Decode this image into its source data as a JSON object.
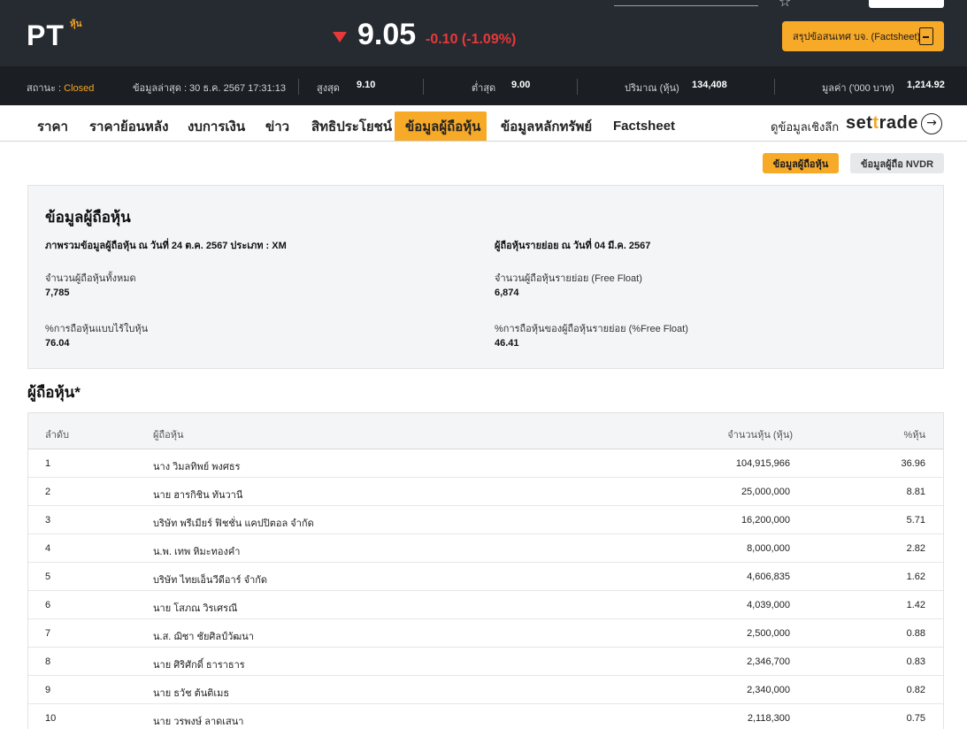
{
  "header": {
    "symbol": "PT",
    "symbol_tag": "หุ้น",
    "price": "9.05",
    "change": "-0.10 (-1.09%)",
    "factsheet_label": "สรุปข้อสนเทศ บจ. (Factsheet)"
  },
  "stats": {
    "status_label": "สถานะ :",
    "status_value": "Closed",
    "updated": "ข้อมูลล่าสุด : 30 ธ.ค. 2567 17:31:13",
    "high_label": "สูงสุด",
    "high_value": "9.10",
    "low_label": "ต่ำสุด",
    "low_value": "9.00",
    "volume_label": "ปริมาณ (หุ้น)",
    "volume_value": "134,408",
    "value_label": "มูลค่า ('000 บาท)",
    "value_value": "1,214.92"
  },
  "tabs": [
    {
      "label": "ราคา"
    },
    {
      "label": "ราคาย้อนหลัง"
    },
    {
      "label": "งบการเงิน"
    },
    {
      "label": "ข่าว"
    },
    {
      "label": "สิทธิประโยชน์"
    },
    {
      "label": "ข้อมูลผู้ถือหุ้น"
    },
    {
      "label": "ข้อมูลหลักทรัพย์"
    },
    {
      "label": "Factsheet"
    }
  ],
  "deep_link": "ดูข้อมูลเชิงลึก",
  "brand": {
    "pre": "set",
    "mid": "t",
    "post": "rade"
  },
  "subtabs": {
    "active": "ข้อมูลผู้ถือหุ้น",
    "inactive": "ข้อมูลผู้ถือ NVDR"
  },
  "summary": {
    "title": "ข้อมูลผู้ถือหุ้น",
    "left_heading": "ภาพรวมข้อมูลผู้ถือหุ้น ณ วันที่ 24 ต.ค. 2567 ประเภท : XM",
    "total_label": "จำนวนผู้ถือหุ้นทั้งหมด",
    "total_value": "7,785",
    "scripless_label": "%การถือหุ้นแบบไร้ใบหุ้น",
    "scripless_value": "76.04",
    "right_heading": "ผู้ถือหุ้นรายย่อย ณ วันที่ 04 มี.ค. 2567",
    "freefloat_label": "จำนวนผู้ถือหุ้นรายย่อย (Free Float)",
    "freefloat_value": "6,874",
    "freefloat_pct_label": "%การถือหุ้นของผู้ถือหุ้นรายย่อย (%Free Float)",
    "freefloat_pct_value": "46.41"
  },
  "holders": {
    "title": "ผู้ถือหุ้น*",
    "headers": {
      "rank": "ลำดับ",
      "name": "ผู้ถือหุ้น",
      "shares": "จำนวนหุ้น (หุ้น)",
      "pct": "%หุ้น"
    },
    "rows": [
      {
        "rank": "1",
        "name": "นาง วิมลทิพย์ พงศธร",
        "shares": "104,915,966",
        "pct": "36.96"
      },
      {
        "rank": "2",
        "name": "นาย ฮารกิชิน ทันวานี",
        "shares": "25,000,000",
        "pct": "8.81"
      },
      {
        "rank": "3",
        "name": "บริษัท พรีเมียร์ ฟิชชั่น แคปปิตอล จำกัด",
        "shares": "16,200,000",
        "pct": "5.71"
      },
      {
        "rank": "4",
        "name": "น.พ. เทพ หิมะทองคำ",
        "shares": "8,000,000",
        "pct": "2.82"
      },
      {
        "rank": "5",
        "name": "บริษัท ไทยเอ็นวีดีอาร์ จำกัด",
        "shares": "4,606,835",
        "pct": "1.62"
      },
      {
        "rank": "6",
        "name": "นาย โสภณ วิรเศรณี",
        "shares": "4,039,000",
        "pct": "1.42"
      },
      {
        "rank": "7",
        "name": "น.ส. ฌิชา ชัยศิลป์วัฒนา",
        "shares": "2,500,000",
        "pct": "0.88"
      },
      {
        "rank": "8",
        "name": "นาย ศิริศักดิ์ ธาราธาร",
        "shares": "2,346,700",
        "pct": "0.83"
      },
      {
        "rank": "9",
        "name": "นาย ธวัช ต้นติเมธ",
        "shares": "2,340,000",
        "pct": "0.82"
      },
      {
        "rank": "10",
        "name": "นาย วรพงษ์ ลาดเสนา",
        "shares": "2,118,300",
        "pct": "0.75"
      }
    ]
  }
}
